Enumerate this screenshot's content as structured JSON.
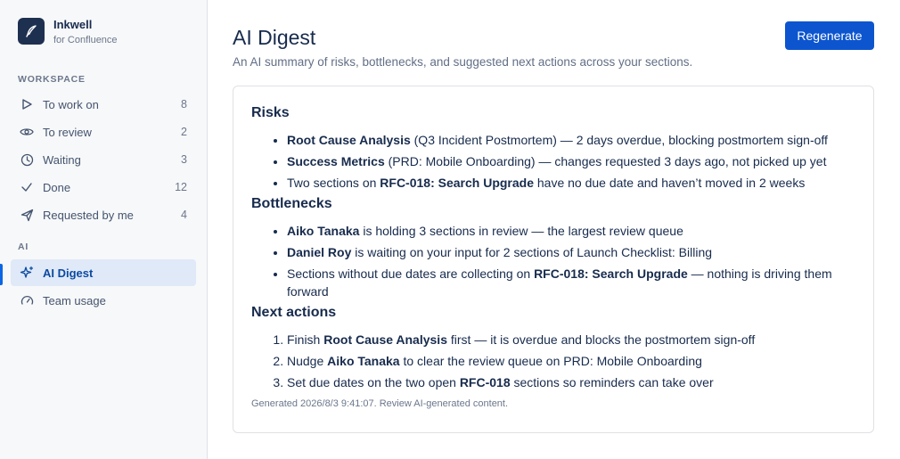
{
  "brand": {
    "name": "Inkwell",
    "sub": "for Confluence"
  },
  "sidebar": {
    "workspace_label": "WORKSPACE",
    "ai_label": "AI",
    "items": [
      {
        "label": "To work on",
        "count": "8",
        "icon": "play-icon"
      },
      {
        "label": "To review",
        "count": "2",
        "icon": "eye-icon"
      },
      {
        "label": "Waiting",
        "count": "3",
        "icon": "clock-icon"
      },
      {
        "label": "Done",
        "count": "12",
        "icon": "check-icon"
      },
      {
        "label": "Requested by me",
        "count": "4",
        "icon": "send-icon"
      },
      {
        "label": "AI Digest",
        "count": "",
        "icon": "sparkle-icon"
      },
      {
        "label": "Team usage",
        "count": "",
        "icon": "gauge-icon"
      }
    ]
  },
  "header": {
    "title": "AI Digest",
    "subtitle": "An AI summary of risks, bottlenecks, and suggested next actions across your sections.",
    "regenerate_label": "Regenerate"
  },
  "digest": {
    "risks_heading": "Risks",
    "risks": [
      {
        "bold": "Root Cause Analysis",
        "text": " (Q3 Incident Postmortem) — 2 days overdue, blocking postmortem sign-off"
      },
      {
        "bold": "Success Metrics",
        "text": " (PRD: Mobile Onboarding) — changes requested 3 days ago, not picked up yet"
      },
      {
        "pre": "Two sections on ",
        "bold": "RFC-018: Search Upgrade",
        "text": " have no due date and haven’t moved in 2 weeks"
      }
    ],
    "bottlenecks_heading": "Bottlenecks",
    "bottlenecks": [
      {
        "bold": "Aiko Tanaka",
        "text": " is holding 3 sections in review — the largest review queue"
      },
      {
        "bold": "Daniel Roy",
        "text": " is waiting on your input for 2 sections of Launch Checklist: Billing"
      },
      {
        "pre": "Sections without due dates are collecting on ",
        "bold": "RFC-018: Search Upgrade",
        "text": " — nothing is driving them forward"
      }
    ],
    "next_heading": "Next actions",
    "next": [
      {
        "pre": "Finish ",
        "bold": "Root Cause Analysis",
        "text": " first — it is overdue and blocks the postmortem sign-off"
      },
      {
        "pre": "Nudge ",
        "bold": "Aiko Tanaka",
        "text": " to clear the review queue on PRD: Mobile Onboarding"
      },
      {
        "pre": "Set due dates on the two open ",
        "bold": "RFC-018",
        "text": " sections so reminders can take over"
      }
    ],
    "footer": "Generated 2026/8/3 9:41:07. Review AI-generated content."
  }
}
